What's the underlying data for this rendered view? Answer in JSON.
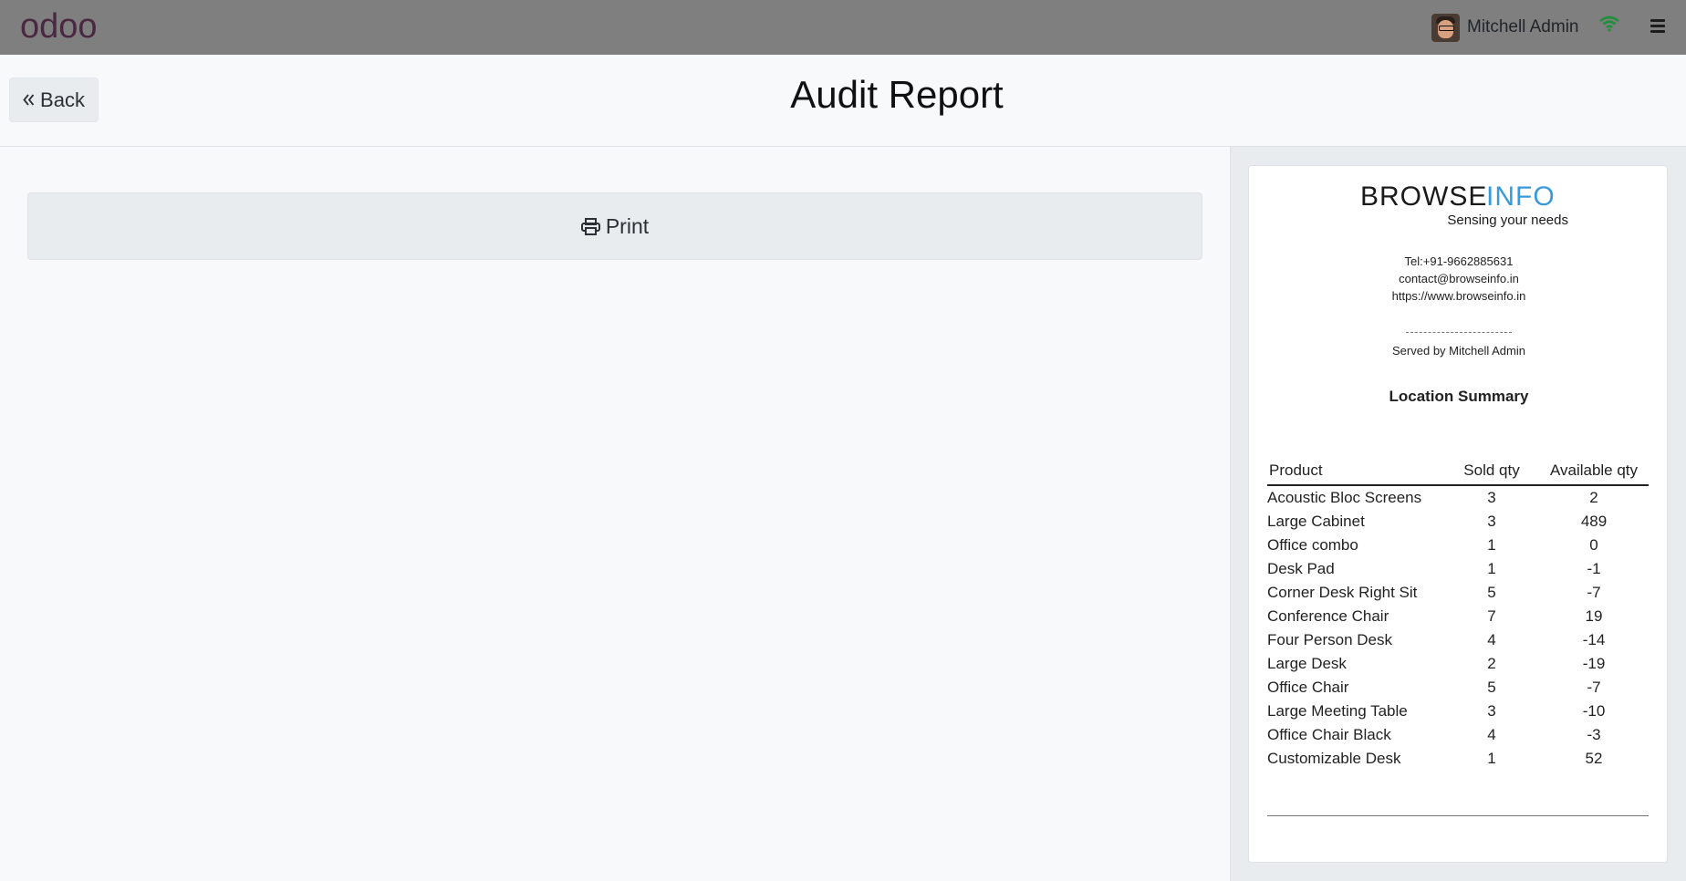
{
  "app": {
    "logo_text": "odoo"
  },
  "navbar": {
    "user_name": "Mitchell Admin",
    "wifi_icon": "wifi-icon",
    "menu_icon": "hamburger-menu-icon",
    "wifi_color": "#28a745"
  },
  "header": {
    "back_label": "Back",
    "title": "Audit Report"
  },
  "actions": {
    "print_label": "Print",
    "print_icon": "printer-icon"
  },
  "receipt": {
    "brand_part1": "BROWSE",
    "brand_part2": "INFO",
    "brand_tagline": "Sensing your needs",
    "brand_color": "#3a9ad9",
    "tel": "Tel:+91-9662885631",
    "email": "contact@browseinfo.in",
    "website": "https://www.browseinfo.in",
    "served_by": "Served by Mitchell Admin",
    "summary_title": "Location Summary",
    "columns": [
      "Product",
      "Sold qty",
      "Available qty"
    ],
    "rows": [
      {
        "product": "Acoustic Bloc Screens",
        "sold": "3",
        "available": "2"
      },
      {
        "product": "Large Cabinet",
        "sold": "3",
        "available": "489"
      },
      {
        "product": "Office combo",
        "sold": "1",
        "available": "0"
      },
      {
        "product": "Desk Pad",
        "sold": "1",
        "available": "-1"
      },
      {
        "product": "Corner Desk Right Sit",
        "sold": "5",
        "available": "-7"
      },
      {
        "product": "Conference Chair",
        "sold": "7",
        "available": "19"
      },
      {
        "product": "Four Person Desk",
        "sold": "4",
        "available": "-14"
      },
      {
        "product": "Large Desk",
        "sold": "2",
        "available": "-19"
      },
      {
        "product": "Office Chair",
        "sold": "5",
        "available": "-7"
      },
      {
        "product": "Large Meeting Table",
        "sold": "3",
        "available": "-10"
      },
      {
        "product": "Office Chair Black",
        "sold": "4",
        "available": "-3"
      },
      {
        "product": "Customizable Desk",
        "sold": "1",
        "available": "52"
      }
    ]
  }
}
